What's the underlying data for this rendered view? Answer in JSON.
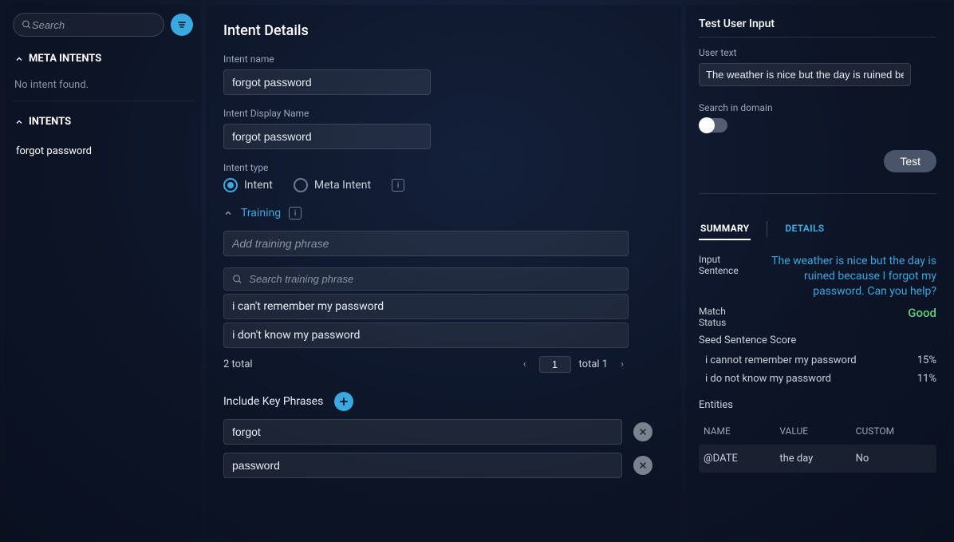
{
  "sidebar": {
    "search_placeholder": "Search",
    "meta_intents_label": "META INTENTS",
    "meta_intents_empty": "No intent found.",
    "intents_label": "INTENTS",
    "intents": [
      {
        "label": "forgot password"
      }
    ]
  },
  "main": {
    "title": "Intent Details",
    "intent_name_label": "Intent name",
    "intent_name_value": "forgot password",
    "display_name_label": "Intent Display Name",
    "display_name_value": "forgot password",
    "intent_type_label": "Intent type",
    "type_options": {
      "intent": "Intent",
      "meta": "Meta Intent"
    },
    "selected_type": "intent",
    "training_label": "Training",
    "add_phrase_placeholder": "Add training phrase",
    "search_phrase_placeholder": "Search training phrase",
    "phrases": [
      "i can't remember my password",
      "i don't know my password"
    ],
    "count_label": "2 total",
    "page_value": "1",
    "total_pages_label": "total 1",
    "key_phrases_label": "Include Key Phrases",
    "key_phrases": [
      "forgot",
      "password"
    ]
  },
  "right": {
    "title": "Test User Input",
    "user_text_label": "User text",
    "user_text_value": "The weather is nice but the day is ruined be",
    "search_domain_label": "Search in domain",
    "test_button": "Test",
    "tabs": {
      "summary": "SUMMARY",
      "details": "DETAILS"
    },
    "input_sentence_label": "Input Sentence",
    "input_sentence_value": "The weather is nice but the day is ruined because I forgot my password. Can you help?",
    "match_status_label": "Match Status",
    "match_status_value": "Good",
    "seed_label": "Seed Sentence Score",
    "seeds": [
      {
        "text": "i cannot remember my password",
        "score": "15%"
      },
      {
        "text": "i do not know my password",
        "score": "11%"
      }
    ],
    "entities_label": "Entities",
    "ent_headers": {
      "name": "NAME",
      "value": "VALUE",
      "custom": "CUSTOM"
    },
    "entities": [
      {
        "name": "@DATE",
        "value": "the day",
        "custom": "No"
      }
    ]
  }
}
